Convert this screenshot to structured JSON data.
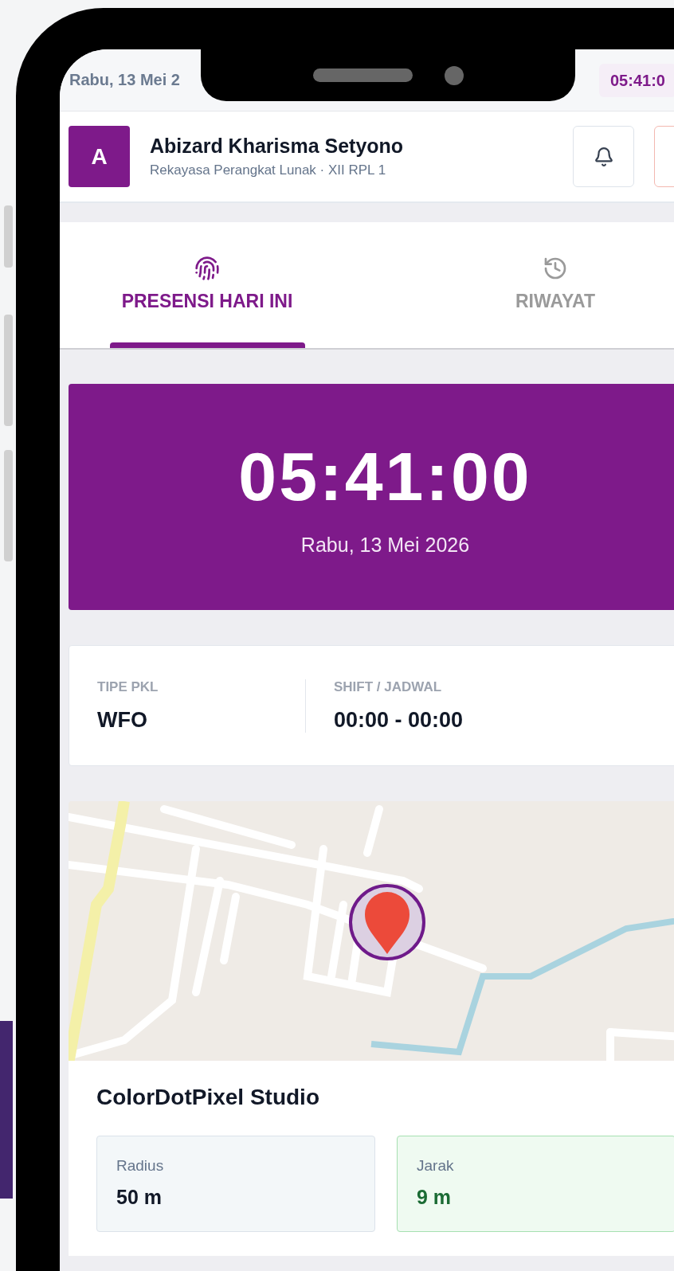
{
  "status_bar": {
    "date": "Rabu, 13 Mei 2",
    "time": "05:41:0"
  },
  "header": {
    "avatar": "A",
    "name": "Abizard Kharisma Setyono",
    "subtitle": "Rekayasa Perangkat Lunak · XII RPL 1"
  },
  "tabs": [
    {
      "label": "PRESENSI HARI INI",
      "kind": "fingerprint",
      "selected": true
    },
    {
      "label": "RIWAYAT",
      "kind": "history",
      "selected": false
    }
  ],
  "clock": {
    "time": "05:41:00",
    "date": "Rabu, 13 Mei 2026"
  },
  "info": [
    {
      "label": "TIPE PKL",
      "value": "WFO"
    },
    {
      "label": "SHIFT / JADWAL",
      "value": "00:00 - 00:00"
    }
  ],
  "location": {
    "name": "ColorDotPixel Studio",
    "stats": [
      {
        "label": "Radius",
        "value": "50 m",
        "kind": "neutral"
      },
      {
        "label": "Jarak",
        "value": "9 m",
        "kind": "ok"
      }
    ]
  }
}
